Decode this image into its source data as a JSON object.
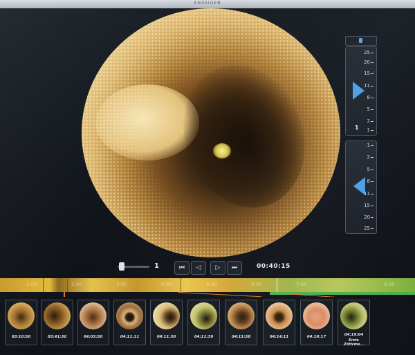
{
  "monitor": {
    "title": "ANZEIGEN"
  },
  "viewer": {
    "image_desc_name": "endoscopy-frame"
  },
  "scale_top": {
    "ticks": [
      "25",
      "20",
      "15",
      "11",
      "8",
      "5",
      "2",
      "1"
    ],
    "value": "1",
    "arrow": "play-forward-icon"
  },
  "scale_bottom": {
    "ticks": [
      "1",
      "2",
      "5",
      "8",
      "11",
      "15",
      "20",
      "25"
    ],
    "arrow": "play-reverse-icon"
  },
  "controls": {
    "speed": "1",
    "time": "00:40:15",
    "buttons": {
      "to_start": "⏮",
      "step_back": "◁",
      "play": "▷",
      "to_end": "⏭"
    }
  },
  "timeline": {
    "labels": [
      "1:00",
      "2:00",
      "3:00",
      "4:00",
      "5:00",
      "6:00",
      "7:00",
      "8:00"
    ],
    "colors": {
      "primary": "#e2b93d",
      "accent": "#4bb04f",
      "connector": "#e07b2a"
    }
  },
  "thumbnails": [
    {
      "time": "03:10:50"
    },
    {
      "time": "03:41:30"
    },
    {
      "time": "04:03:50"
    },
    {
      "time": "04:11:11"
    },
    {
      "time": "04:11:30"
    },
    {
      "time": "04:11:39"
    },
    {
      "time": "04:11:58"
    },
    {
      "time": "04:14:11"
    },
    {
      "time": "04:18:17"
    },
    {
      "time": "04:19:04",
      "caption": "Erste Zöttcme..."
    }
  ]
}
